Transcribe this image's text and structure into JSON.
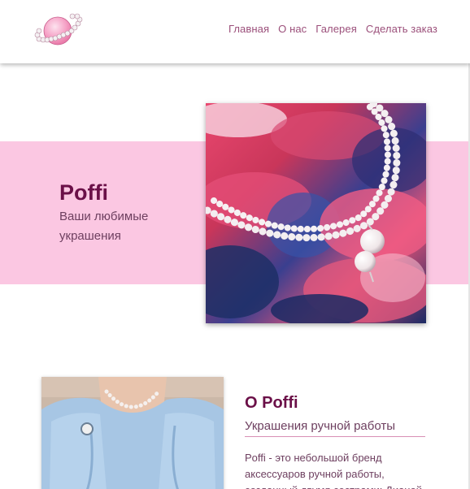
{
  "header": {
    "logo_icon": "pearl-planet-logo-icon",
    "nav": [
      {
        "label": "Главная"
      },
      {
        "label": "О нас"
      },
      {
        "label": "Галерея"
      },
      {
        "label": "Сделать заказ"
      }
    ]
  },
  "hero": {
    "title": "Poffi",
    "subtitle": "Ваши любимые украшения",
    "image": "pearl-bracelet-on-clouds-photo",
    "band_color": "#fbc7e2"
  },
  "about": {
    "title": "О Poffi",
    "subtitle": "Украшения ручной работы",
    "text": "Poffi - это небольшой бренд аксессуаров ручной работы, созданный двумя сестрами: Дианой",
    "image": "person-wearing-pearl-necklace-photo"
  },
  "colors": {
    "accent_dark": "#6b1048",
    "pink": "#fbc7e2",
    "nav_text": "#9b4f7a"
  }
}
